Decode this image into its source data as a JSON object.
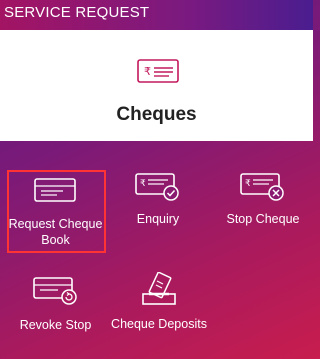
{
  "topbar": {
    "title": "SERVICE REQUEST"
  },
  "header": {
    "title": "Cheques",
    "icon": "cheque-icon"
  },
  "tiles": [
    {
      "label": "Request Cheque Book",
      "icon": "cheque-icon",
      "selected": true
    },
    {
      "label": "Enquiry",
      "icon": "cheque-check-icon"
    },
    {
      "label": "Stop Cheque",
      "icon": "cheque-cancel-icon"
    },
    {
      "label": "Revoke Stop",
      "icon": "cheque-revoke-icon"
    },
    {
      "label": "Cheque Deposits",
      "icon": "cheque-deposit-icon"
    }
  ],
  "colors": {
    "accent": "#c2185b",
    "selection_border": "#ff3333",
    "header_bg": "#ffffff"
  }
}
